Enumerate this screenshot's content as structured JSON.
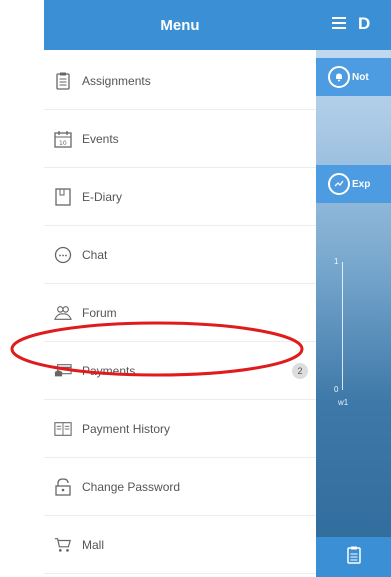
{
  "drawer": {
    "title": "Menu",
    "items": [
      {
        "label": "Assignments",
        "icon": "clipboard-icon"
      },
      {
        "label": "Events",
        "icon": "calendar-icon"
      },
      {
        "label": "E-Diary",
        "icon": "diary-icon"
      },
      {
        "label": "Chat",
        "icon": "chat-icon"
      },
      {
        "label": "Forum",
        "icon": "forum-icon"
      },
      {
        "label": "Payments",
        "icon": "payment-card-icon",
        "badge": "2"
      },
      {
        "label": "Payment History",
        "icon": "payment-history-icon"
      },
      {
        "label": "Change Password",
        "icon": "lock-icon"
      },
      {
        "label": "Mall",
        "icon": "shopping-cart-icon"
      }
    ]
  },
  "main": {
    "title": "D",
    "notifications_label": "Not",
    "expenses_label": "Exp",
    "axis_top_label": "1",
    "axis_bottom_label": "0",
    "axis_x_label": "w1"
  },
  "colors": {
    "header": "#3b8fd4",
    "highlight": "#e01b1b",
    "text": "#555555"
  }
}
